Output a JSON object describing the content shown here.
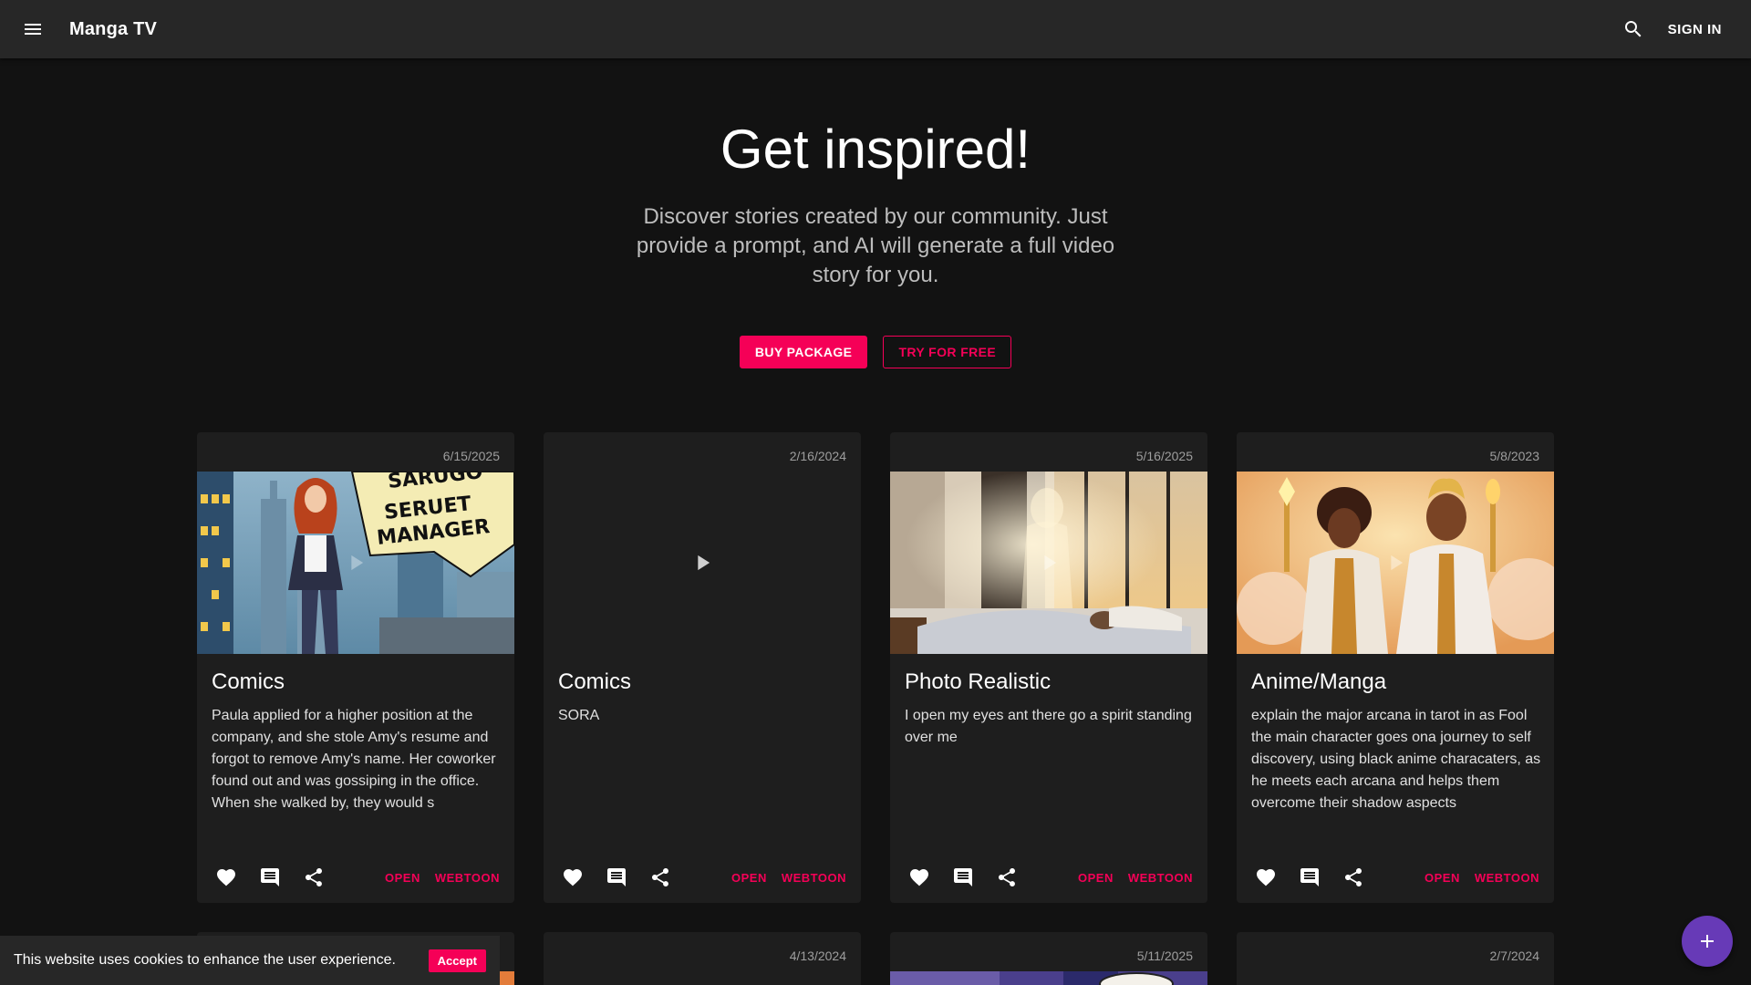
{
  "app": {
    "title": "Manga TV",
    "signin_label": "SIGN IN"
  },
  "hero": {
    "title": "Get inspired!",
    "subtitle": "Discover stories created by our community. Just provide a prompt, and AI will generate a full video story for you.",
    "buy_label": "BUY PACKAGE",
    "try_label": "TRY FOR FREE"
  },
  "cards": [
    {
      "date": "6/15/2025",
      "title": "Comics",
      "description": "Paula applied for a higher position at the company, and she stole Amy's resume and forgot to remove Amy's name. Her coworker found out and was gossiping in the office. When she walked by, they would s",
      "image_text_1": "SARUGO",
      "image_text_2": "SERUET",
      "image_text_3": "MANAGER",
      "open_label": "OPEN",
      "webtoon_label": "WEBTOON"
    },
    {
      "date": "2/16/2024",
      "title": "Comics",
      "description": "SORA",
      "open_label": "OPEN",
      "webtoon_label": "WEBTOON"
    },
    {
      "date": "5/16/2025",
      "title": "Photo Realistic",
      "description": "I open my eyes ant there go a spirit standing over me",
      "open_label": "OPEN",
      "webtoon_label": "WEBTOON"
    },
    {
      "date": "5/8/2023",
      "title": "Anime/Manga",
      "description": "explain the major arcana in tarot in as Fool the main character goes ona journey to self discovery, using black anime characaters, as he meets each arcana and helps them overcome their shadow aspects",
      "open_label": "OPEN",
      "webtoon_label": "WEBTOON"
    }
  ],
  "row2_dates": [
    "4/13/2024",
    "5/11/2025",
    "2/7/2024"
  ],
  "cookie": {
    "text": "This website uses cookies to enhance the user experience.",
    "accept_label": "Accept"
  },
  "icons": {
    "menu": "menu-icon",
    "search": "search-icon",
    "play": "play-icon",
    "like": "heart-icon",
    "comment": "comment-icon",
    "share": "share-icon",
    "fab": "plus-icon"
  },
  "colors": {
    "accent": "#f50057",
    "fab": "#673ab7",
    "appbar": "#272727",
    "card": "#1e1e1e",
    "background": "#121212"
  }
}
